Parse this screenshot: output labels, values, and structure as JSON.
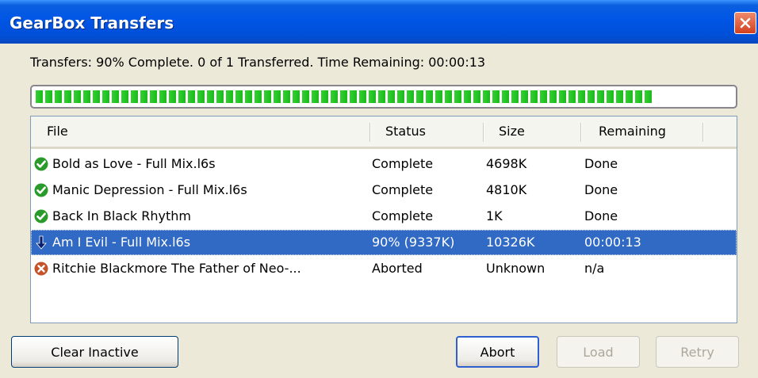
{
  "window": {
    "title": "GearBox Transfers",
    "close_icon": "close-icon"
  },
  "summary": "Transfers: 90% Complete. 0 of 1 Transferred. Time Remaining: 00:00:13",
  "progress": {
    "percent": 90,
    "color": "#22c322"
  },
  "columns": {
    "file": "File",
    "status": "Status",
    "size": "Size",
    "remaining": "Remaining"
  },
  "rows": [
    {
      "icon": "check-icon",
      "file": "Bold as Love - Full Mix.l6s",
      "status": "Complete",
      "size": "4698K",
      "remaining": "Done"
    },
    {
      "icon": "check-icon",
      "file": "Manic Depression - Full Mix.l6s",
      "status": "Complete",
      "size": "4810K",
      "remaining": "Done"
    },
    {
      "icon": "check-icon",
      "file": "Back In Black Rhythm",
      "status": "Complete",
      "size": "1K",
      "remaining": "Done"
    },
    {
      "icon": "download-arrow-icon",
      "file": "Am I Evil - Full Mix.l6s",
      "status": "90% (9337K)",
      "size": "10326K",
      "remaining": "00:00:13",
      "selected": true
    },
    {
      "icon": "error-icon",
      "file": "Ritchie Blackmore The Father of Neo-...",
      "status": "Aborted",
      "size": "Unknown",
      "remaining": "n/a"
    }
  ],
  "buttons": {
    "clear_inactive": "Clear Inactive",
    "abort": "Abort",
    "load": "Load",
    "retry": "Retry"
  },
  "colors": {
    "titlebar": "#0055e5",
    "selection": "#316ac5",
    "check": "#2a9a2a",
    "error": "#c4522a"
  }
}
